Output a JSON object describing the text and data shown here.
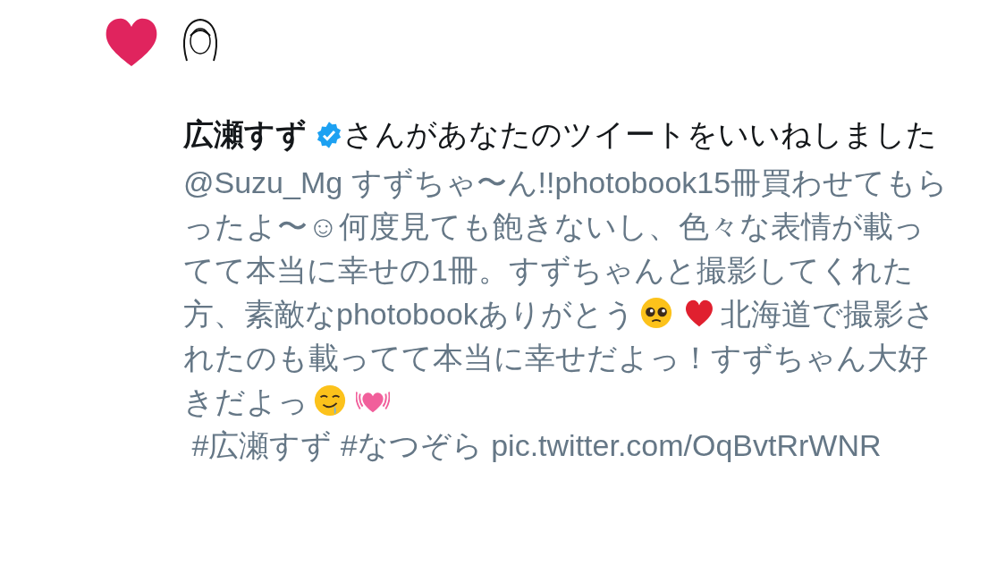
{
  "notification": {
    "liker": "広瀬すず",
    "verified": true,
    "action": "さんがあなたのツイートをいいねしました"
  },
  "tweet": [
    {
      "kind": "text",
      "text": "@Suzu_Mg すずちゃ〜ん!!photobook15冊買わせてもらったよ〜☺何度見ても飽きないし、色々な表情が載ってて本当に幸せの1冊。すずちゃんと撮影してくれた方、素敵なphotobookありがとう"
    },
    {
      "kind": "pleading-face"
    },
    {
      "kind": "heart"
    },
    {
      "kind": "text",
      "text": "北海道で撮影されたのも載ってて本当に幸せだよっ！すずちゃん大好きだよっ"
    },
    {
      "kind": "drooling-face"
    },
    {
      "kind": "growing-heart"
    },
    {
      "kind": "text",
      "text": "\n #広瀬すず #なつぞら pic.twitter.com/OqBvtRrWNR"
    }
  ]
}
